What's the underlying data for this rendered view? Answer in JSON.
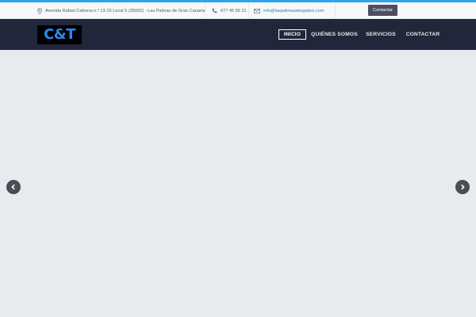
{
  "topbar": {
    "address": "Avenida Rafael Cabrera n.º 13-15 Local 5 (35002) - Las Palmas de Gran Canaria",
    "phone": "677 45 99 21",
    "email": "info@laspalmasabogados.com",
    "contact_button": "Contactar",
    "icons": [
      "map-pin-icon",
      "phone-icon",
      "envelope-icon"
    ]
  },
  "header": {
    "logo_text": "C&T",
    "nav": [
      {
        "label": "INICIO",
        "active": true
      },
      {
        "label": "QUIÉNES SOMOS",
        "active": false
      },
      {
        "label": "SERVICIOS",
        "active": false
      },
      {
        "label": "CONTACTAR",
        "active": false
      }
    ]
  },
  "slider": {
    "prev_icon": "chevron-left-icon",
    "next_icon": "chevron-right-icon"
  },
  "colors": {
    "accent": "#2ea3f2",
    "nav_background": "#22263a",
    "logo_text": "#2a8af0",
    "contact_button": "#4b4d63",
    "slider_background": "#e8ebee"
  }
}
